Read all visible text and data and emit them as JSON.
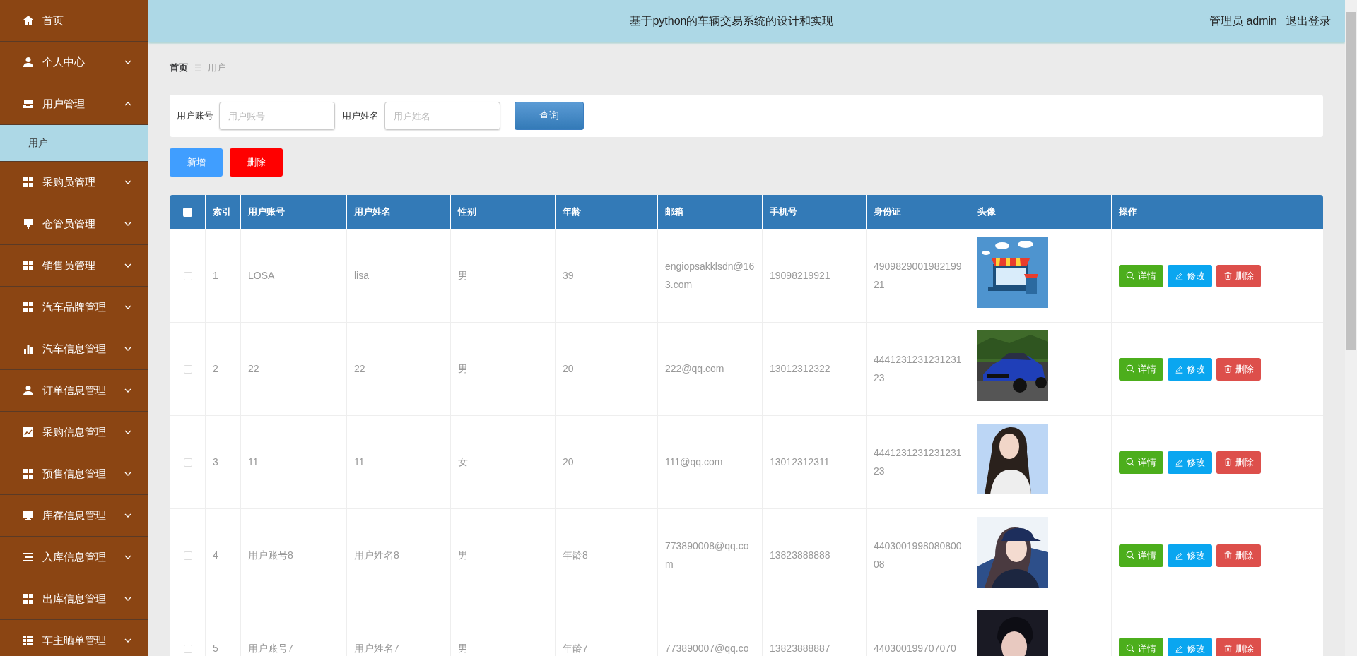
{
  "sidebar": {
    "items": [
      {
        "label": "首页",
        "kind": "link"
      },
      {
        "label": "个人中心",
        "kind": "group",
        "expanded": false
      },
      {
        "label": "用户管理",
        "kind": "group",
        "expanded": true,
        "children": [
          {
            "label": "用户",
            "selected": true
          }
        ]
      },
      {
        "label": "采购员管理",
        "kind": "group",
        "expanded": false
      },
      {
        "label": "仓管员管理",
        "kind": "group",
        "expanded": false
      },
      {
        "label": "销售员管理",
        "kind": "group",
        "expanded": false
      },
      {
        "label": "汽车品牌管理",
        "kind": "group",
        "expanded": false
      },
      {
        "label": "汽车信息管理",
        "kind": "group",
        "expanded": false
      },
      {
        "label": "订单信息管理",
        "kind": "group",
        "expanded": false
      },
      {
        "label": "采购信息管理",
        "kind": "group",
        "expanded": false
      },
      {
        "label": "预售信息管理",
        "kind": "group",
        "expanded": false
      },
      {
        "label": "库存信息管理",
        "kind": "group",
        "expanded": false
      },
      {
        "label": "入库信息管理",
        "kind": "group",
        "expanded": false
      },
      {
        "label": "出库信息管理",
        "kind": "group",
        "expanded": false
      },
      {
        "label": "车主晒单管理",
        "kind": "group",
        "expanded": false
      }
    ]
  },
  "header": {
    "title": "基于python的车辆交易系统的设计和实现",
    "user": "管理员 admin",
    "logout": "退出登录"
  },
  "breadcrumb": [
    "首页",
    "用户"
  ],
  "search": {
    "fields": [
      {
        "label": "用户账号",
        "placeholder": "用户账号"
      },
      {
        "label": "用户姓名",
        "placeholder": "用户姓名"
      }
    ],
    "button": "查询"
  },
  "actions": [
    {
      "label": "新增",
      "kind": "add"
    },
    {
      "label": "删除",
      "kind": "delete"
    }
  ],
  "table": {
    "all_checked": false,
    "columns": [
      "索引",
      "用户账号",
      "用户姓名",
      "性别",
      "年龄",
      "邮箱",
      "手机号",
      "身份证",
      "头像",
      "操作"
    ],
    "rows": [
      {
        "checked": false,
        "cells": [
          "1",
          "LOSA",
          "lisa",
          "男",
          "39",
          "engiopsakklsdn@163.com",
          "19098219921",
          "490982900198219921"
        ],
        "buttons": [
          "详情",
          "修改",
          "删除"
        ]
      },
      {
        "checked": false,
        "cells": [
          "2",
          "22",
          "22",
          "男",
          "20",
          "222@qq.com",
          "13012312322",
          "444123123123123123"
        ],
        "buttons": [
          "详情",
          "修改",
          "删除"
        ]
      },
      {
        "checked": false,
        "cells": [
          "3",
          "11",
          "11",
          "女",
          "20",
          "111@qq.com",
          "13012312311",
          "444123123123123123"
        ],
        "buttons": [
          "详情",
          "修改",
          "删除"
        ]
      },
      {
        "checked": false,
        "cells": [
          "4",
          "用户账号8",
          "用户姓名8",
          "男",
          "年龄8",
          "773890008@qq.com",
          "13823888888",
          "440300199808080008"
        ],
        "buttons": [
          "详情",
          "修改",
          "删除"
        ]
      },
      {
        "checked": false,
        "cells": [
          "5",
          "用户账号7",
          "用户姓名7",
          "男",
          "年龄7",
          "773890007@qq.co",
          "13823888887",
          "440300199707070"
        ],
        "buttons": [
          "详情",
          "修改",
          "删除"
        ]
      }
    ]
  }
}
